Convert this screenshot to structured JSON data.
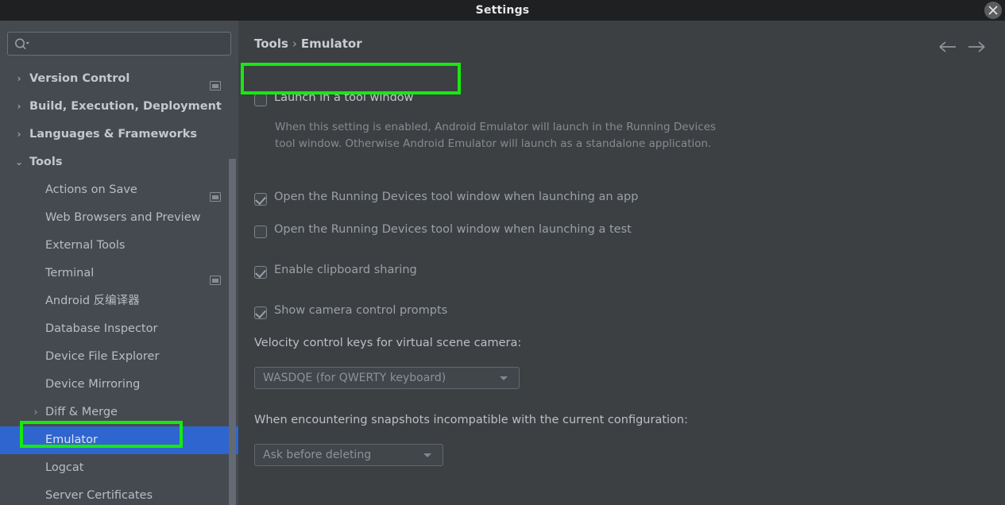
{
  "window": {
    "title": "Settings",
    "close_icon": "close-icon"
  },
  "sidebar": {
    "search": {
      "value": "",
      "placeholder": "",
      "icon": "search-icon"
    },
    "items": [
      {
        "label": "Version Control",
        "level": 0,
        "chevron": "chevron-right",
        "bold": true,
        "badge": true,
        "selected": false
      },
      {
        "label": "Build, Execution, Deployment",
        "level": 0,
        "chevron": "chevron-right",
        "bold": true,
        "badge": false,
        "selected": false
      },
      {
        "label": "Languages & Frameworks",
        "level": 0,
        "chevron": "chevron-right",
        "bold": true,
        "badge": false,
        "selected": false
      },
      {
        "label": "Tools",
        "level": 0,
        "chevron": "chevron-down",
        "bold": true,
        "badge": false,
        "selected": false
      },
      {
        "label": "Actions on Save",
        "level": 1,
        "chevron": "",
        "bold": false,
        "badge": true,
        "selected": false
      },
      {
        "label": "Web Browsers and Preview",
        "level": 1,
        "chevron": "",
        "bold": false,
        "badge": false,
        "selected": false
      },
      {
        "label": "External Tools",
        "level": 1,
        "chevron": "",
        "bold": false,
        "badge": false,
        "selected": false
      },
      {
        "label": "Terminal",
        "level": 1,
        "chevron": "",
        "bold": false,
        "badge": true,
        "selected": false
      },
      {
        "label": "Android 反编译器",
        "level": 1,
        "chevron": "",
        "bold": false,
        "badge": false,
        "selected": false
      },
      {
        "label": "Database Inspector",
        "level": 1,
        "chevron": "",
        "bold": false,
        "badge": false,
        "selected": false
      },
      {
        "label": "Device File Explorer",
        "level": 1,
        "chevron": "",
        "bold": false,
        "badge": false,
        "selected": false
      },
      {
        "label": "Device Mirroring",
        "level": 1,
        "chevron": "",
        "bold": false,
        "badge": false,
        "selected": false
      },
      {
        "label": "Diff & Merge",
        "level": 1,
        "chevron": "chevron-right",
        "bold": false,
        "badge": false,
        "selected": false
      },
      {
        "label": "Emulator",
        "level": 1,
        "chevron": "",
        "bold": false,
        "badge": false,
        "selected": true
      },
      {
        "label": "Logcat",
        "level": 1,
        "chevron": "",
        "bold": false,
        "badge": false,
        "selected": false
      },
      {
        "label": "Server Certificates",
        "level": 1,
        "chevron": "",
        "bold": false,
        "badge": false,
        "selected": false
      }
    ]
  },
  "breadcrumb": {
    "parent": "Tools",
    "separator": "›",
    "current": "Emulator"
  },
  "nav": {
    "back_icon": "arrow-left-icon",
    "forward_icon": "arrow-right-icon"
  },
  "settings": {
    "launch_tool_window": {
      "label": "Launch in a tool window",
      "checked": false,
      "description": "When this setting is enabled, Android Emulator will launch in the Running Devices tool window. Otherwise Android Emulator will launch as a standalone application."
    },
    "open_on_app": {
      "label": "Open the Running Devices tool window when launching an app",
      "checked": true
    },
    "open_on_test": {
      "label": "Open the Running Devices tool window when launching a test",
      "checked": false
    },
    "clipboard_sharing": {
      "label": "Enable clipboard sharing",
      "checked": true
    },
    "camera_prompts": {
      "label": "Show camera control prompts",
      "checked": true
    },
    "velocity_keys": {
      "label": "Velocity control keys for virtual scene camera:",
      "value": "WASDQE (for QWERTY keyboard)"
    },
    "incompatible_snapshots": {
      "label": "When encountering snapshots incompatible with the current configuration:",
      "value": "Ask before deleting"
    }
  },
  "annotations": {
    "highlight_color": "#17e80f",
    "selection_color": "#2f65cf",
    "targets": [
      "launch-in-a-tool-window-checkbox",
      "sidebar-item-emulator"
    ]
  }
}
